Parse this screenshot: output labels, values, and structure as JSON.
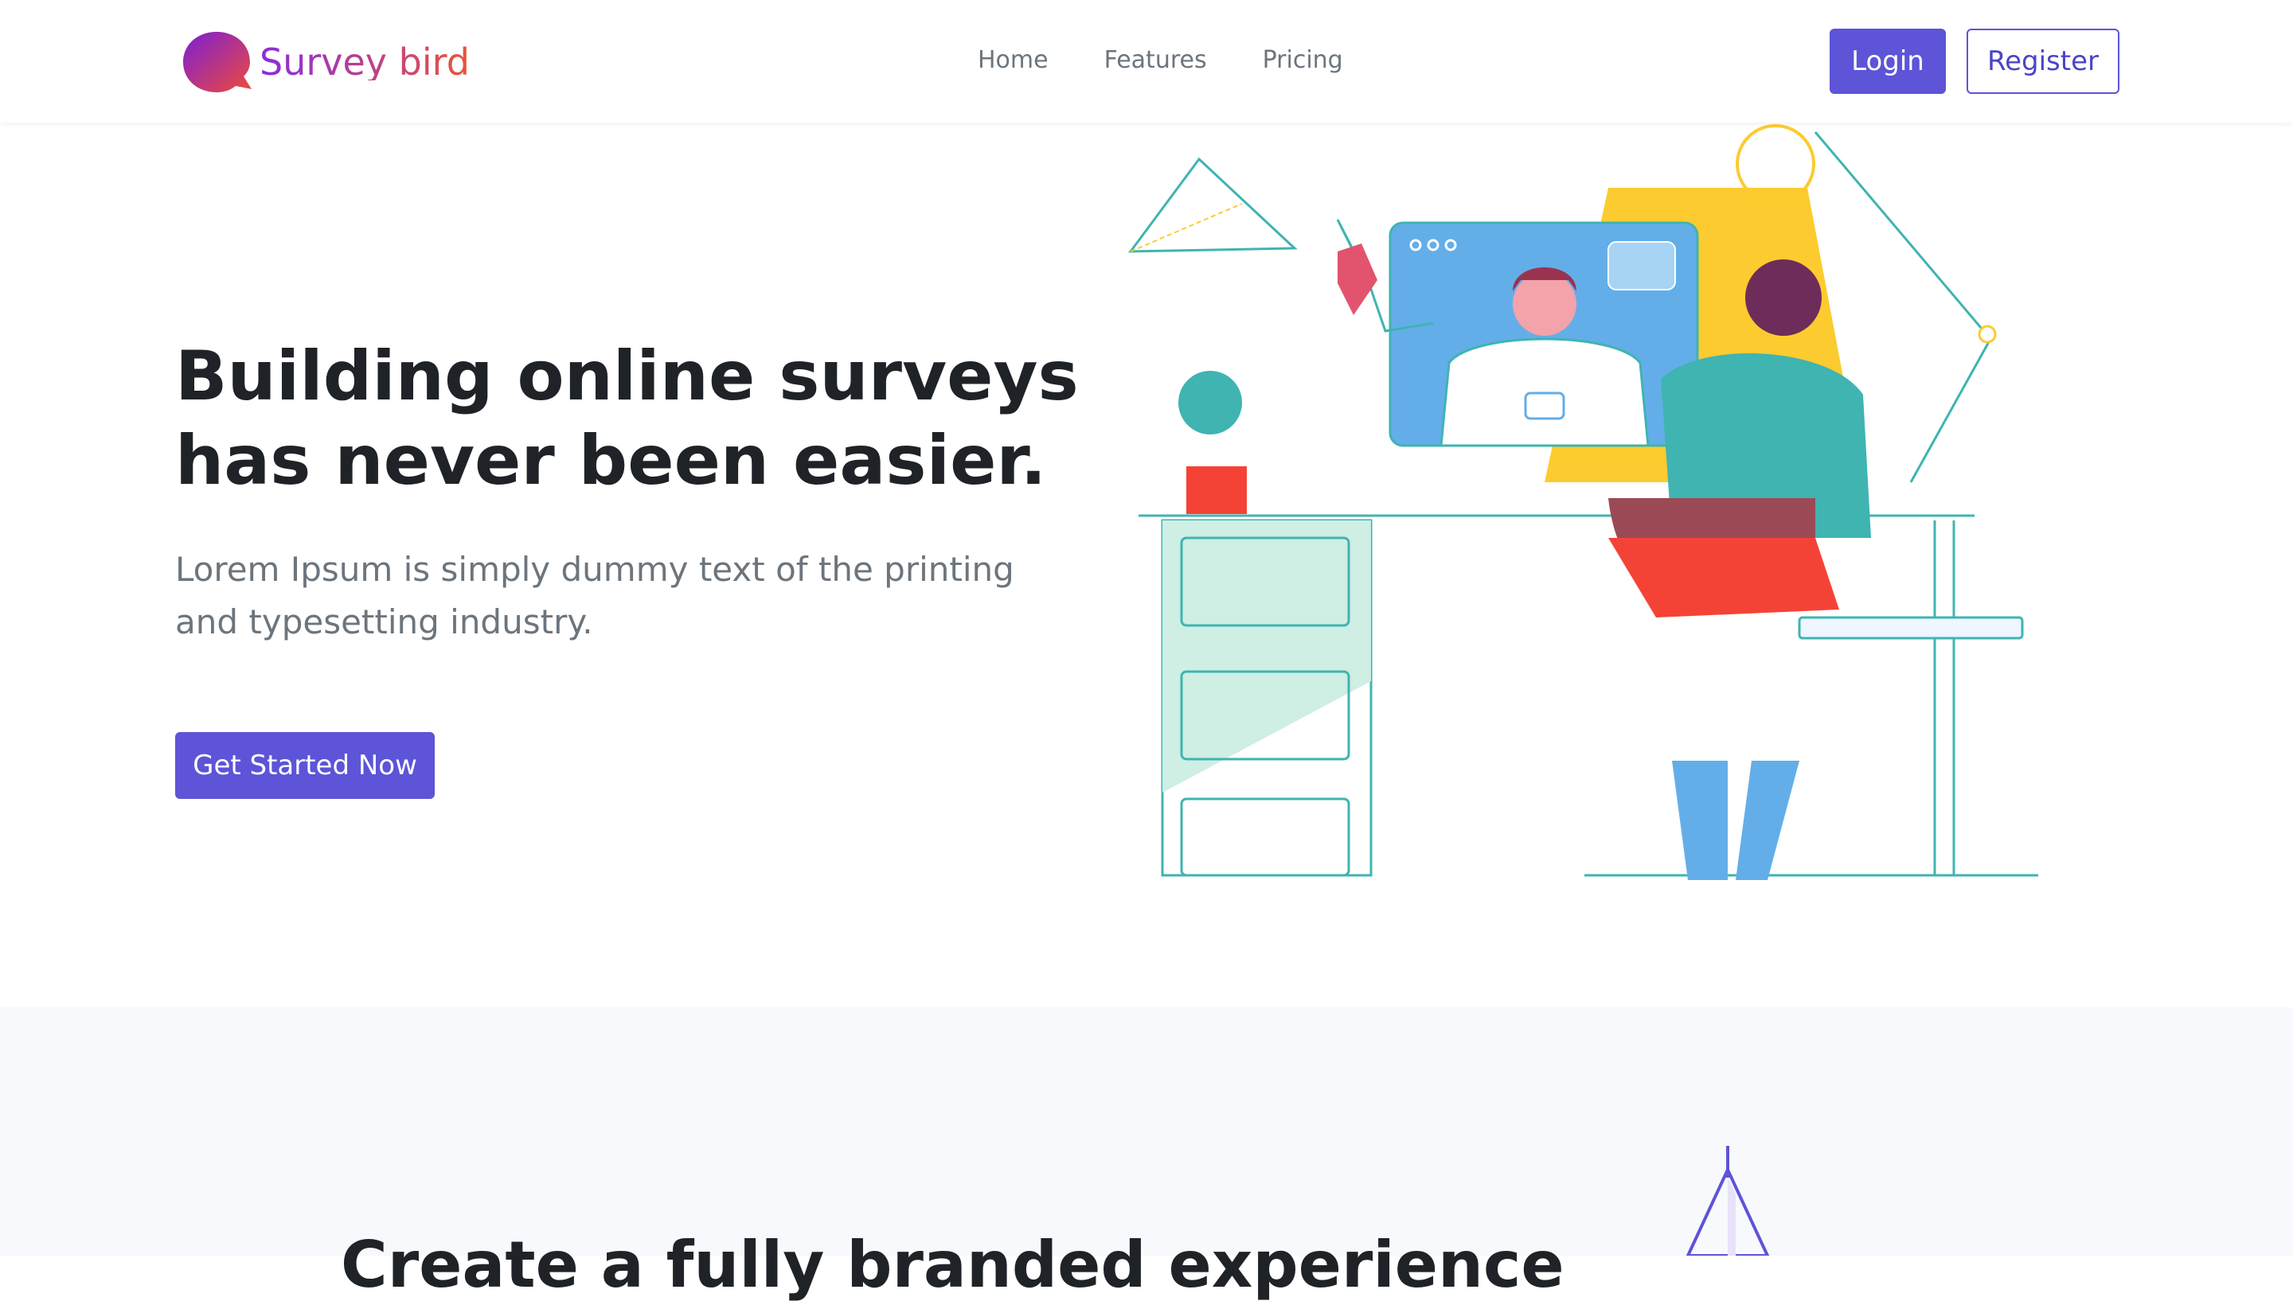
{
  "brand": {
    "name": "Survey bird",
    "gradient_start": "#8a2be2",
    "gradient_end": "#e8553a"
  },
  "nav": {
    "links": [
      "Home",
      "Features",
      "Pricing"
    ]
  },
  "auth": {
    "login_label": "Login",
    "register_label": "Register"
  },
  "hero": {
    "title": "Building online surveys has never been easier.",
    "subtitle": "Lorem Ipsum is simply dummy text of the printing and typesetting industry.",
    "cta_label": "Get Started Now",
    "illustration": "video-call-woman-at-desk-illustration"
  },
  "section2": {
    "heading": "Create a fully branded experience",
    "illustration": "pencil-illustration"
  },
  "colors": {
    "accent": "#5d54d8",
    "text_dark": "#1f2327",
    "text_muted": "#6c757d",
    "section_bg": "#f8f9fc"
  }
}
